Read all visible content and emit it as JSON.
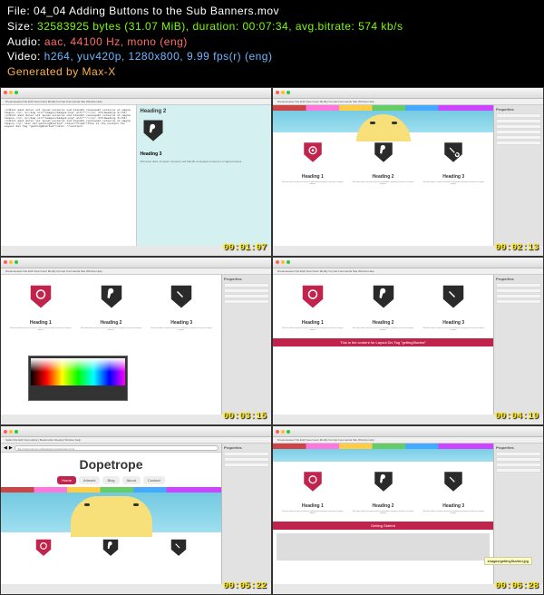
{
  "info": {
    "file_label": "File:",
    "file_value": "04_04 Adding Buttons to the Sub Banners.mov",
    "size_label": "Size:",
    "size_value": "32583925 bytes (31.07 MiB), duration: 00:07:34, avg.bitrate: 574 kb/s",
    "audio_label": "Audio:",
    "audio_value": "aac, 44100 Hz, mono (eng)",
    "video_label": "Video:",
    "video_value": "h264, yuv420p, 1280x800,  9.99 fps(r) (eng)",
    "gen_text": "Generated by Max-X"
  },
  "app_menu": "Dreamweaver  File  Edit  View  Insert  Modify  Format  Commands  Site  Window  Help",
  "safari_menu": "Safari  File  Edit  View  History  Bookmarks  Develop  Window  Help",
  "prop_title": "Properties",
  "timestamps": [
    "00:01:07",
    "00:02:13",
    "00:03:15",
    "00:04:19",
    "00:05:22",
    "00:06:28"
  ],
  "headings": {
    "h1": "Heading 1",
    "h2": "Heading 2",
    "h3": "Heading 3",
    "lorem": "Nisl amet dolor sit ipsum veroeros sed blandit consequat veroeros et magna tempus."
  },
  "code_sample": "<p>Nisl amet dolor sit ipsum veroeros sed blandit consequat veroeros et magna tempus.</p>\n<p><img src=\"images/badge2.png\" alt=\"\"/></p>\n\n<h3>Heading 3</h3>\n<p>Nisl amet dolor sit ipsum veroeros sed blandit consequat veroeros et magna tempus.</p>\n<p><img src=\"images/badge3.png\" alt=\"\"/></p>\n\n<h3>Heading 3</h3>\n<p>Nisl amet dolor sit ipsum veroeros sed blandit consequat veroeros et magna tempus.</p>\n\n<div id=\"gettingStarted\" class=\"fluid\">This is the content for Layout Div Tag \"gettingStarted\"</div>\n</section>",
  "pink_text": "This is the content for Layout Div Tag \"gettingStarted\"",
  "getting_started": "Getting Started",
  "dopetrope": {
    "title": "Dopetrope",
    "nav": [
      "Home",
      "Artwork",
      "Blog",
      "About",
      "Contact"
    ],
    "url": "file:///Users/anonym/Desktop/mysite/index.html"
  },
  "tooltip": "images/gettingStarted.jpg",
  "badge_colors": {
    "red": "#c0244d",
    "dark": "#2a2a2a"
  }
}
